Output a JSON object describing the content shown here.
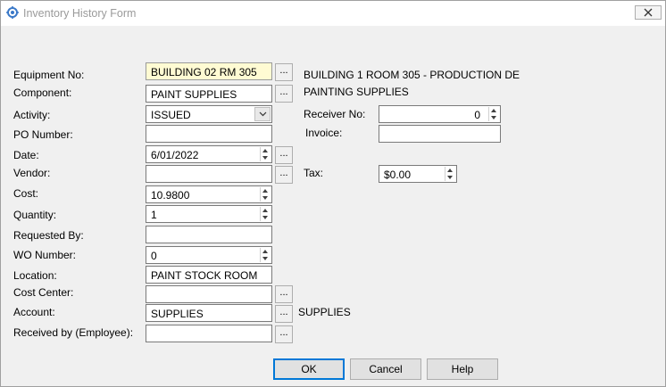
{
  "window": {
    "title": "Inventory History Form"
  },
  "fields": {
    "equipment_no": {
      "label": "Equipment No:",
      "value": "BUILDING 02 RM 305",
      "desc": "BUILDING 1 ROOM 305 - PRODUCTION DE"
    },
    "component": {
      "label": "Component:",
      "value": "PAINT SUPPLIES",
      "desc": "PAINTING SUPPLIES"
    },
    "activity": {
      "label": "Activity:",
      "value": "ISSUED"
    },
    "po_number": {
      "label": "PO Number:",
      "value": ""
    },
    "date": {
      "label": "Date:",
      "value": "6/01/2022"
    },
    "vendor": {
      "label": "Vendor:",
      "value": ""
    },
    "cost": {
      "label": "Cost:",
      "value": "10.9800"
    },
    "quantity": {
      "label": "Quantity:",
      "value": "1"
    },
    "requested_by": {
      "label": "Requested By:",
      "value": ""
    },
    "wo_number": {
      "label": "WO Number:",
      "value": "0"
    },
    "location": {
      "label": "Location:",
      "value": "PAINT STOCK ROOM"
    },
    "cost_center": {
      "label": "Cost Center:",
      "value": ""
    },
    "account": {
      "label": "Account:",
      "value": "SUPPLIES",
      "desc": "SUPPLIES"
    },
    "received_by": {
      "label": "Received by (Employee):",
      "value": ""
    },
    "receiver_no": {
      "label": "Receiver No:",
      "value": "0"
    },
    "invoice": {
      "label": "Invoice:",
      "value": ""
    },
    "tax": {
      "label": "Tax:",
      "value": "$0.00"
    }
  },
  "buttons": {
    "ok": "OK",
    "cancel": "Cancel",
    "help": "Help",
    "lookup": "..."
  },
  "colors": {
    "default_border": "#0078d7",
    "highlight_bg": "#fffbd3"
  }
}
